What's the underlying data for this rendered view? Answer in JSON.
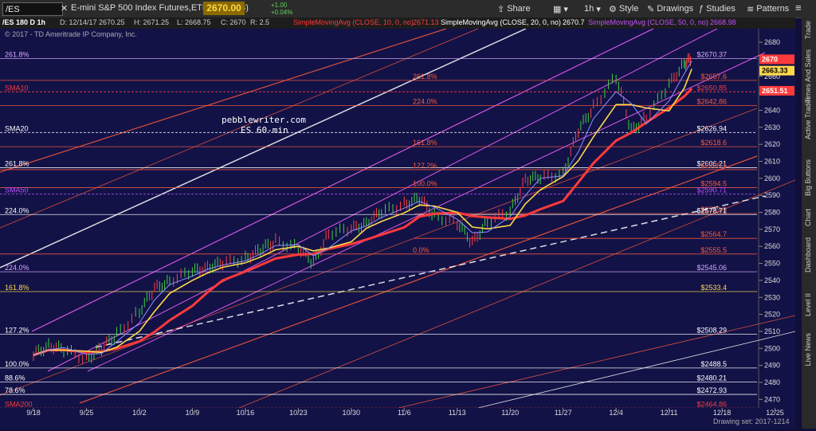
{
  "toolbar": {
    "symbol": "/ES",
    "description": "E-mini S&P 500 Index Futures,ETH (MAR 18)",
    "last_price": "2670.00",
    "change": "+1.00",
    "change_pct": "+0.04%",
    "share_label": "Share",
    "timeframe": "1h",
    "style_label": "Style",
    "drawings_label": "Drawings",
    "studies_label": "Studies",
    "patterns_label": "Patterns"
  },
  "infobar": {
    "title": "/ES 180 D 1h",
    "date": "D: 12/14/17 2670.25",
    "high": "H: 2671.25",
    "low": "L: 2668.75",
    "close": "C: 2670",
    "range": "R: 2.5",
    "sma10_label": "SimpleMovingAvg (CLOSE, 10, 0, no)",
    "sma10_val": "2671.13",
    "sma20_label": "SimpleMovingAvg (CLOSE, 20, 0, no)",
    "sma20_val": "2670.7",
    "sma50_label": "SimpleMovingAvg (CLOSE, 50, 0, no)",
    "sma50_val": "2668.98"
  },
  "copyright": "© 2017 - TD Ameritrade IP Company, Inc.",
  "watermark": {
    "line1": "pebblewriter.com",
    "line2": "ES 60-min"
  },
  "drawing_set": "Drawing set: 2017-1214",
  "right_tabs": [
    "Trade",
    "Times And Sales",
    "Active Trader",
    "Big Buttons",
    "Chart",
    "Dashboard",
    "Level II",
    "Live News"
  ],
  "colors": {
    "bg": "#121247",
    "sma10": "#ff3a3a",
    "sma20": "#ffffff",
    "sma50": "#c050ff",
    "price_hl": "#ffd84a"
  },
  "chart_data": {
    "type": "line",
    "title": "/ES 180 D 1h",
    "ylim": [
      2465,
      2688
    ],
    "y_ticks": [
      2470,
      2480,
      2490,
      2500,
      2510,
      2520,
      2530,
      2540,
      2550,
      2560,
      2570,
      2580,
      2590,
      2600,
      2610,
      2620,
      2630,
      2640,
      2650,
      2660,
      2670,
      2680
    ],
    "x_ticks": [
      "9/18",
      "9/25",
      "10/2",
      "10/9",
      "10/16",
      "10/23",
      "10/30",
      "11/6",
      "11/13",
      "11/20",
      "11/27",
      "12/4",
      "12/11",
      "12/18",
      "12/25"
    ],
    "price_series": [
      [
        "9/18",
        2496
      ],
      [
        "9/20",
        2502
      ],
      [
        "9/22",
        2499
      ],
      [
        "9/25",
        2494
      ],
      [
        "9/27",
        2500
      ],
      [
        "9/29",
        2508
      ],
      [
        "10/2",
        2522
      ],
      [
        "10/4",
        2535
      ],
      [
        "10/6",
        2540
      ],
      [
        "10/9",
        2545
      ],
      [
        "10/11",
        2548
      ],
      [
        "10/13",
        2550
      ],
      [
        "10/16",
        2553
      ],
      [
        "10/18",
        2558
      ],
      [
        "10/20",
        2563
      ],
      [
        "10/23",
        2559
      ],
      [
        "10/25",
        2550
      ],
      [
        "10/27",
        2568
      ],
      [
        "10/30",
        2570
      ],
      [
        "11/1",
        2574
      ],
      [
        "11/3",
        2580
      ],
      [
        "11/6",
        2585
      ],
      [
        "11/8",
        2588
      ],
      [
        "11/10",
        2578
      ],
      [
        "11/13",
        2574
      ],
      [
        "11/15",
        2562
      ],
      [
        "11/17",
        2575
      ],
      [
        "11/20",
        2580
      ],
      [
        "11/22",
        2600
      ],
      [
        "11/24",
        2600
      ],
      [
        "11/27",
        2603
      ],
      [
        "11/29",
        2628
      ],
      [
        "12/1",
        2642
      ],
      [
        "12/4",
        2660
      ],
      [
        "12/6",
        2628
      ],
      [
        "12/8",
        2636
      ],
      [
        "12/11",
        2655
      ],
      [
        "12/13",
        2668
      ],
      [
        "12/14",
        2670
      ]
    ],
    "series": [
      {
        "name": "SMA10",
        "color": "#ffd84a"
      },
      {
        "name": "SMA20",
        "color": "#ff3a3a"
      },
      {
        "name": "SMA50",
        "color": "#c050ff"
      }
    ],
    "levels": [
      {
        "label": "$2670.37",
        "value": 2670.37,
        "left_label": "261.8%",
        "color": "#d9a8ff"
      },
      {
        "label": "$2657.6",
        "value": 2657.6,
        "left_label": "261.8%",
        "color": "#ff5a3a"
      },
      {
        "label": "$2650.85",
        "value": 2650.85,
        "left_label": "SMA10",
        "color": "#ff3a3a"
      },
      {
        "label": "$2642.86",
        "value": 2642.86,
        "left_label": "224.0%",
        "color": "#ff5a3a"
      },
      {
        "label": "$2626.94",
        "value": 2626.94,
        "left_label": "SMA20",
        "color": "#ffffff"
      },
      {
        "label": "$2618.6",
        "value": 2618.6,
        "left_label": "161.8%",
        "color": "#ff5a3a"
      },
      {
        "label": "$2606.21",
        "value": 2606.21,
        "left_label": "261.8%",
        "color": "#ffffff"
      },
      {
        "label": "$2605.1",
        "value": 2605.1,
        "left_label": "127.2%",
        "color": "#ff5a3a"
      },
      {
        "label": "$2594.5",
        "value": 2594.5,
        "left_label": "100.0%",
        "color": "#ff5a3a"
      },
      {
        "label": "$2590.71",
        "value": 2590.71,
        "left_label": "SMA50",
        "color": "#c050ff"
      },
      {
        "label": "$2579.3",
        "value": 2579.3,
        "left_label": "",
        "color": "#ff5a3a"
      },
      {
        "label": "$2578.71",
        "value": 2578.71,
        "left_label": "224.0%",
        "color": "#ffffff"
      },
      {
        "label": "$2564.7",
        "value": 2564.7,
        "left_label": "",
        "color": "#ff5a3a"
      },
      {
        "label": "$2555.5",
        "value": 2555.5,
        "left_label": "0.0%",
        "color": "#ff5a3a"
      },
      {
        "label": "$2545.06",
        "value": 2545.06,
        "left_label": "224.0%",
        "color": "#d9a8ff"
      },
      {
        "label": "$2533.4",
        "value": 2533.4,
        "left_label": "161.8%",
        "color": "#ffd84a"
      },
      {
        "label": "$2508.29",
        "value": 2508.29,
        "left_label": "127.2%",
        "color": "#ffffff"
      },
      {
        "label": "$2488.5",
        "value": 2488.5,
        "left_label": "100.0%",
        "color": "#ffffff"
      },
      {
        "label": "$2480.21",
        "value": 2480.21,
        "left_label": "88.6%",
        "color": "#ffffff"
      },
      {
        "label": "$2472.93",
        "value": 2472.93,
        "left_label": "78.6%",
        "color": "#ffffff"
      },
      {
        "label": "$2464.86",
        "value": 2464.86,
        "left_label": "SMA200",
        "color": "#ff3a3a"
      }
    ],
    "price_tags": [
      {
        "label": "2670",
        "value": 2670,
        "bg": "#ff3a3a",
        "fg": "#ffffff"
      },
      {
        "label": "2663.33",
        "value": 2663.33,
        "bg": "#ffd84a",
        "fg": "#000000"
      },
      {
        "label": "2651.51",
        "value": 2651.51,
        "bg": "#ff3a3a",
        "fg": "#ffffff"
      }
    ]
  }
}
